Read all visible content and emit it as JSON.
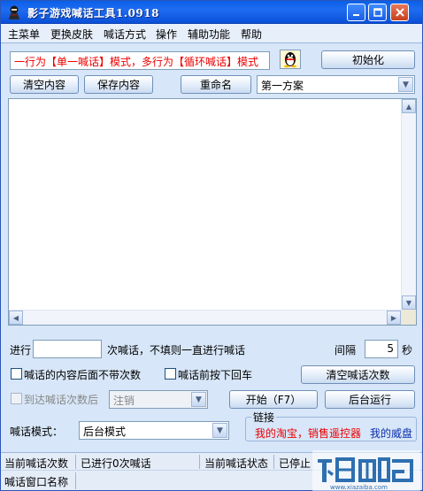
{
  "window": {
    "title": "影子游戏喊话工具1.0918"
  },
  "menu": [
    "主菜单",
    "更换皮肤",
    "喊话方式",
    "操作",
    "辅助功能",
    "帮助"
  ],
  "mode_text": "一行为【单一喊话】模式，多行为【循环喊话】模式",
  "buttons": {
    "init": "初始化",
    "clear_content": "清空内容",
    "save_content": "保存内容",
    "rename": "重命名",
    "clear_count": "清空喊话次数",
    "start": "开始（F7）",
    "background_run": "后台运行"
  },
  "scheme_select": {
    "value": "第一方案"
  },
  "textarea": {
    "value": ""
  },
  "run_row": {
    "prefix": "进行",
    "count_value": "",
    "suffix": "次喊话，不填则一直进行喊话",
    "interval_label": "间隔",
    "interval_value": "5",
    "interval_unit": "秒"
  },
  "checks": {
    "no_count_suffix": "喊话的内容后面不带次数",
    "press_enter": "喊话前按下回车",
    "after_reached": "到达喊话次数后"
  },
  "after_action_select": {
    "value": "注销"
  },
  "mode_row": {
    "label": "喊话模式：",
    "value": "后台模式"
  },
  "links": {
    "legend": "链接",
    "taobao": "我的淘宝，销售遥控器",
    "weidian": "我的威盘"
  },
  "status": {
    "count_label": "当前喊话次数",
    "count_value": "已进行0次喊话",
    "state_label": "当前喊话状态",
    "state_value": "已停止",
    "window_label": "喊话窗口名称"
  },
  "watermark": {
    "brand": "下载吧",
    "domain": "www.xiazaiba.com"
  },
  "colors": {
    "titlebar": "#0a5fe8",
    "background": "#d7e6f8",
    "red_text": "#ee0000",
    "blue_text": "#0a2fae"
  }
}
